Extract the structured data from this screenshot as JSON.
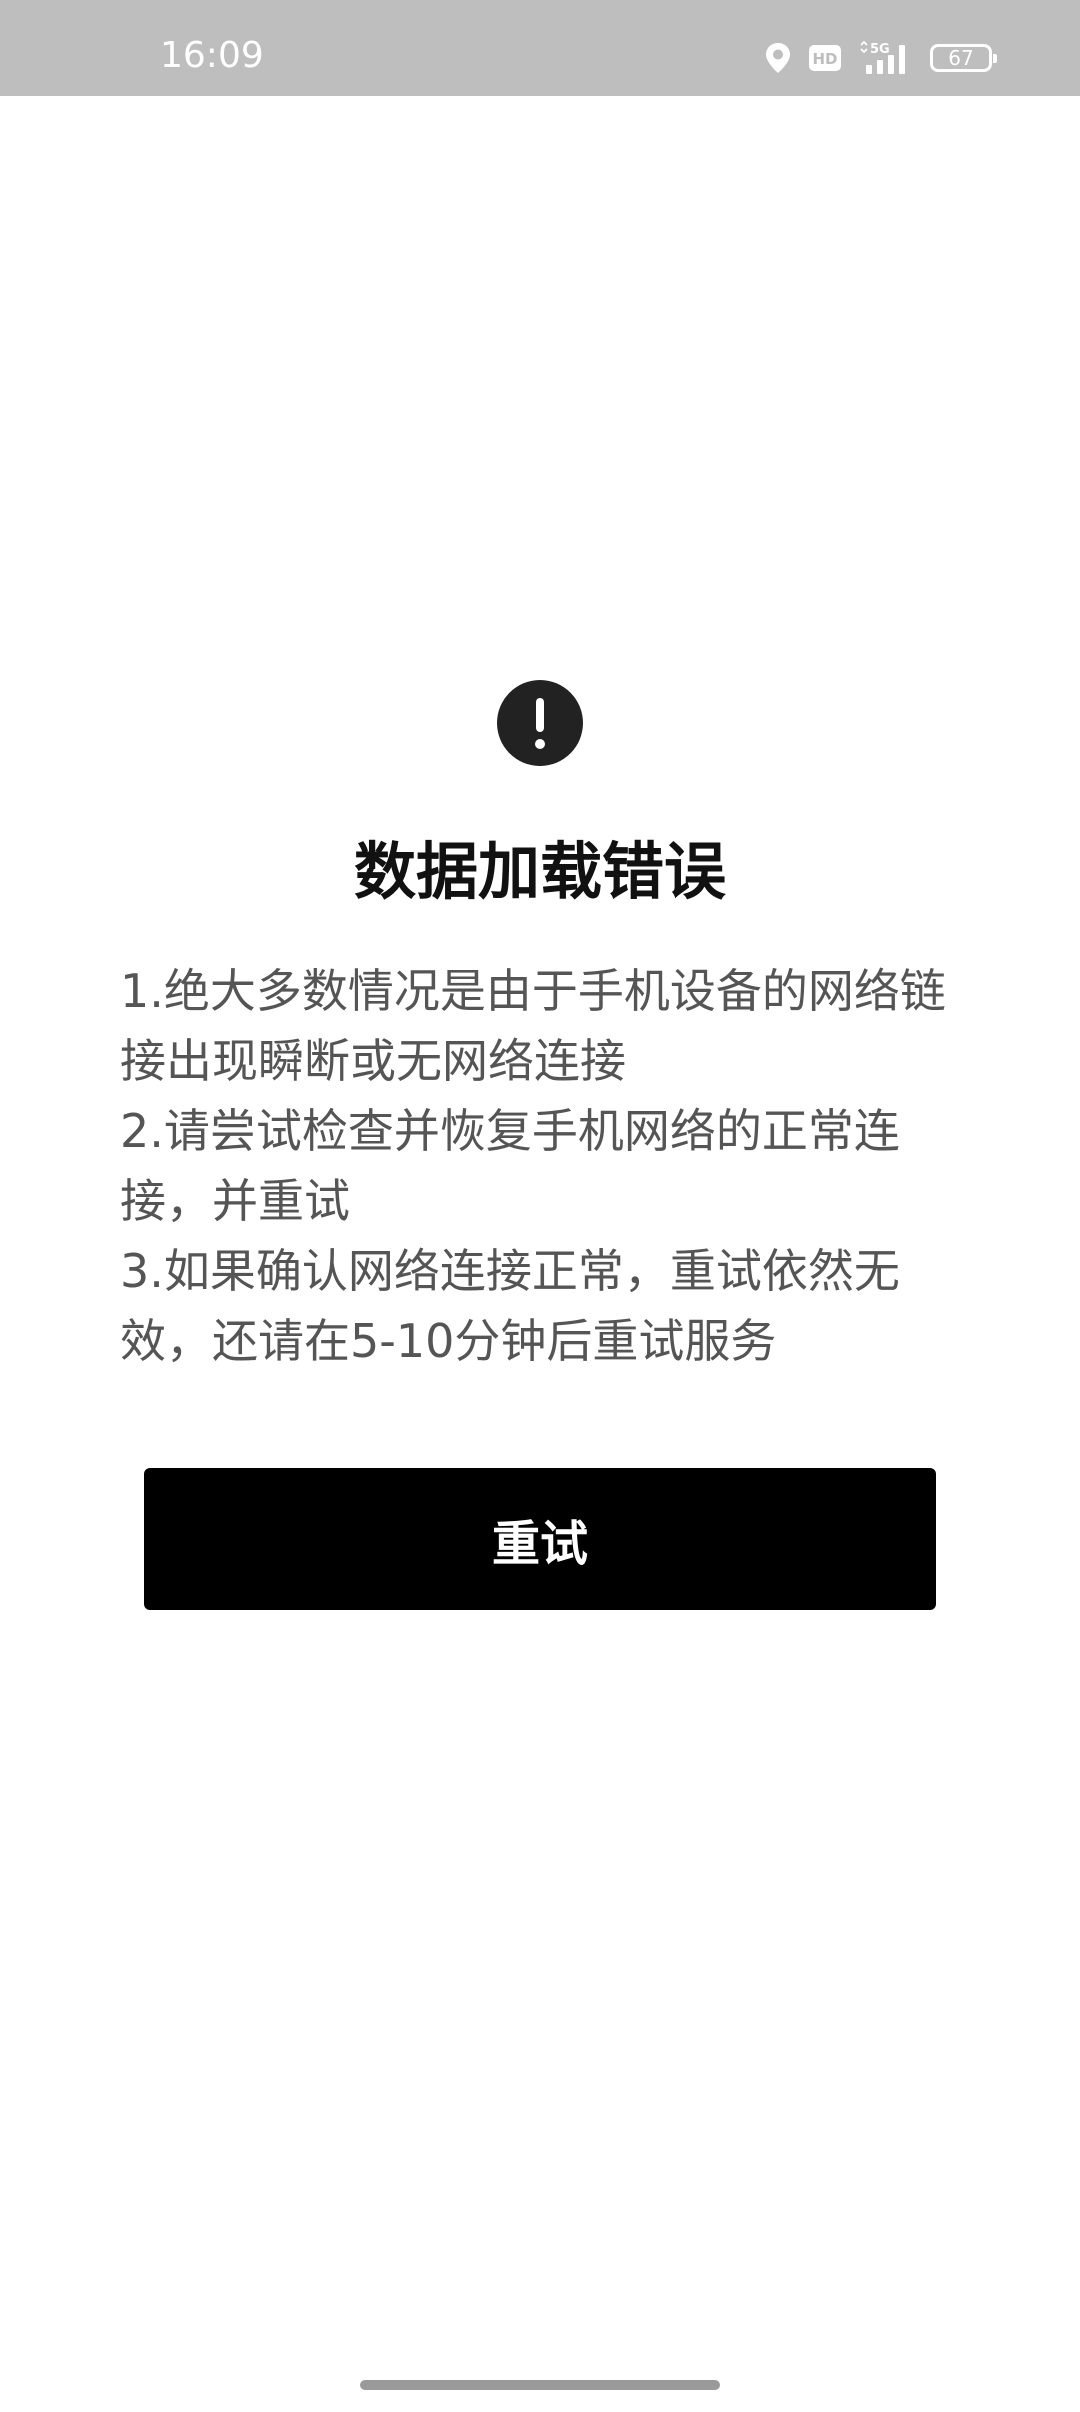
{
  "status_bar": {
    "time": "16:09",
    "icons": [
      "location-icon",
      "hd-icon",
      "5g-signal-icon",
      "battery-icon"
    ],
    "hd_label": "HD",
    "network_label": "5G",
    "battery_level": "67"
  },
  "error": {
    "icon": "exclamation-icon",
    "title": "数据加载错误",
    "lines": [
      "1.绝大多数情况是由于手机设备的网络链接出现瞬断或无网络连接",
      "2.请尝试检查并恢复手机网络的正常连接，并重试",
      "3.如果确认网络连接正常，重试依然无效，还请在5-10分钟后重试服务"
    ],
    "retry_label": "重试"
  },
  "colors": {
    "status_bar_bg": "#bebebe",
    "button_bg": "#000000",
    "icon_bg": "#222222"
  }
}
